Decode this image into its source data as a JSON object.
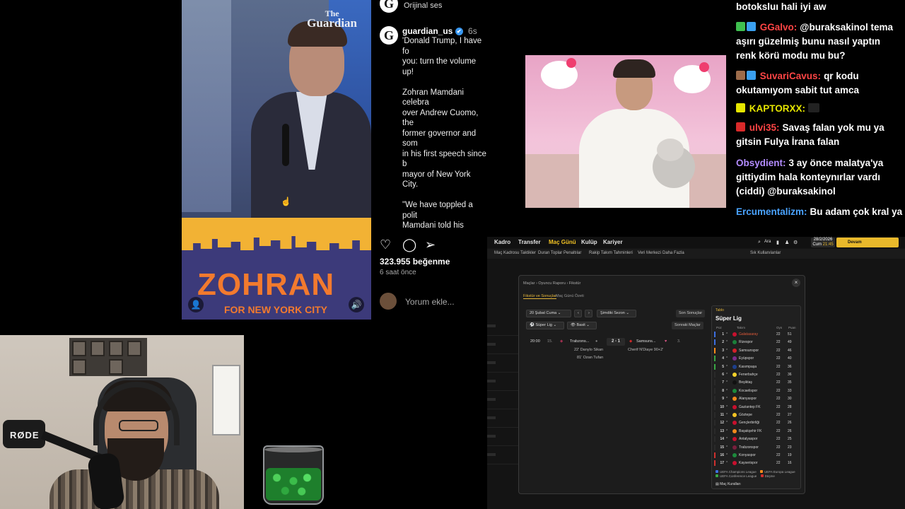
{
  "instagram": {
    "watermark_small": "The",
    "watermark_big": "Guardian",
    "prev_sub": "Orijinal ses",
    "author": "guardian_us",
    "verified": "✔",
    "time_ago": "6s",
    "caption": "'Donald Trump, I have fo\nyou: turn the volume up!\n\nZohran Mamdani celebra\nover Andrew Cuomo, the\nformer governor and som\nin his first speech since b\nmayor of New York City.\n\n\"We have toppled a polit\nMamdani told his suppo\ndelivering a message to \nwish Andrew Cuomo onl\nprivate life but let tonigh\ntime I utter his name.\"\n\nMamdani also used the s\ndirectly address Donald T\nthreatened to cut fundin",
    "likes": "323.955 beğenme",
    "posted": "6 saat önce",
    "comment_placeholder": "Yorum ekle...",
    "podium_text": "ZOHRAN",
    "podium_sub": "FOR NEW YORK CITY"
  },
  "chat": {
    "messages": [
      {
        "user": "",
        "text": "botoksluı hali iyi aw",
        "color": "#ffffff"
      },
      {
        "user": "GGalvo:",
        "text": "@buraksakinol tema aşırı güzelmiş bunu nasıl yaptın renk körü modu mu bu?",
        "color": "#ff4545"
      },
      {
        "user": "SuvariCavus:",
        "text": "qr kodu okutamıyom sabit tut amca",
        "color": "#ff4545"
      },
      {
        "user": "KAPTORXX:",
        "text": "",
        "color": "#e6e600"
      },
      {
        "user": "ulvi35:",
        "text": "Savaş falan yok mu ya gitsin Fulya İrana falan",
        "color": "#ff4545"
      },
      {
        "user": "Obsydient:",
        "text": "3 ay önce malatya'ya gittiydim hala konteynırlar vardı (ciddi) @buraksakinol",
        "color": "#b38cff"
      },
      {
        "user": "Ercumentalizm:",
        "text": "Bu adam çok kral ya",
        "color": "#4aa3ff"
      }
    ]
  },
  "webcam": {
    "mic_brand": "RØDE"
  },
  "game": {
    "nav": [
      "Kadro",
      "Transfer",
      "Maç Günü",
      "Kulüp",
      "Kariyer"
    ],
    "subnav": [
      "Maç Kadrosu",
      "Taktikler",
      "Duran Toplar",
      "Penaltılar",
      "Rakip Takım Tahminleri",
      "Veri Merkezi",
      "Daha Fazla"
    ],
    "search": "Ara",
    "date": "28/2/2026",
    "date_day": "Cum",
    "time": "21:45",
    "continue": "Devam",
    "sub_right": "Sık Kullanılanlar",
    "dialog": {
      "breadcrumb": "Maçlar  ›  Oyuncu Raporu  ›  Fikstür",
      "tabs": [
        "Fikstür ve Sonuçlar",
        "Maç Günü Özeti"
      ],
      "round": "20 Şubat Cuma",
      "season": "Şimdiki Sezon",
      "league": "Süper Lig",
      "view": "Basit",
      "prev_results": "Son Sonuçlar",
      "next_matches": "Sonraki Maçlar",
      "match_time": "20:00",
      "match_round": "15.",
      "home_team": "Trabzons...",
      "score": "2 - 1",
      "away_team": "Samsuns...",
      "away_round": "3.",
      "scorer_home_1": "22' Danylo Sikan",
      "scorer_away": "Cherif N'Diaye  90+2'",
      "scorer_home_2": "81' Ozan Tufan"
    },
    "league_panel": {
      "tag": "Tablo",
      "title": "Süper Lig",
      "headers": [
        "Poz",
        "Takım",
        "Oyn",
        "Puan"
      ],
      "rows": [
        {
          "pos": "1",
          "team": "Galatasaray",
          "played": "22",
          "pts": "51",
          "stripe": "#3d6fe0",
          "crest": "#c8102e"
        },
        {
          "pos": "2",
          "team": "Rizespor",
          "played": "22",
          "pts": "49",
          "stripe": "#3d6fe0",
          "crest": "#1b7f3a"
        },
        {
          "pos": "3",
          "team": "Samsunspor",
          "played": "22",
          "pts": "46",
          "stripe": "#ff8c1a",
          "crest": "#d4202a"
        },
        {
          "pos": "4",
          "team": "Eyüpspor",
          "played": "22",
          "pts": "40",
          "stripe": "#39a845",
          "crest": "#7b2d8c"
        },
        {
          "pos": "5",
          "team": "Kasımpaşa",
          "played": "22",
          "pts": "36",
          "stripe": "#39a845",
          "crest": "#1d3f8c"
        },
        {
          "pos": "6",
          "team": "Fenerbahçe",
          "played": "22",
          "pts": "36",
          "stripe": "#2a2a2a",
          "crest": "#f3d12a"
        },
        {
          "pos": "7",
          "team": "Beşiktaş",
          "played": "22",
          "pts": "35",
          "stripe": "#2a2a2a",
          "crest": "#111111"
        },
        {
          "pos": "8",
          "team": "Kocaelispor",
          "played": "22",
          "pts": "33",
          "stripe": "#2a2a2a",
          "crest": "#1c8a3c"
        },
        {
          "pos": "9",
          "team": "Alanyaspor",
          "played": "22",
          "pts": "30",
          "stripe": "#2a2a2a",
          "crest": "#f18a1c"
        },
        {
          "pos": "10",
          "team": "Gaziantep FK",
          "played": "22",
          "pts": "28",
          "stripe": "#2a2a2a",
          "crest": "#c8102e"
        },
        {
          "pos": "11",
          "team": "Göztepe",
          "played": "22",
          "pts": "27",
          "stripe": "#2a2a2a",
          "crest": "#f3c324"
        },
        {
          "pos": "12",
          "team": "Gençlerbirliği",
          "played": "22",
          "pts": "26",
          "stripe": "#2a2a2a",
          "crest": "#c8102e"
        },
        {
          "pos": "13",
          "team": "Başakşehir FK",
          "played": "22",
          "pts": "26",
          "stripe": "#2a2a2a",
          "crest": "#f18a1c"
        },
        {
          "pos": "14",
          "team": "Antalyaspor",
          "played": "22",
          "pts": "25",
          "stripe": "#2a2a2a",
          "crest": "#c8102e"
        },
        {
          "pos": "15",
          "team": "Trabzonspor",
          "played": "22",
          "pts": "23",
          "stripe": "#2a2a2a",
          "crest": "#7a1f3d"
        },
        {
          "pos": "16",
          "team": "Konyaspor",
          "played": "22",
          "pts": "19",
          "stripe": "#d0302e",
          "crest": "#1c8a3c"
        },
        {
          "pos": "17",
          "team": "Kayserispor",
          "played": "22",
          "pts": "16",
          "stripe": "#d0302e",
          "crest": "#c8102e"
        }
      ],
      "legend": [
        "UEFA Champions League",
        "UEFA Europa League",
        "UEFA Conference League",
        "Düşme"
      ],
      "footer": "Maç Kuralları"
    }
  }
}
